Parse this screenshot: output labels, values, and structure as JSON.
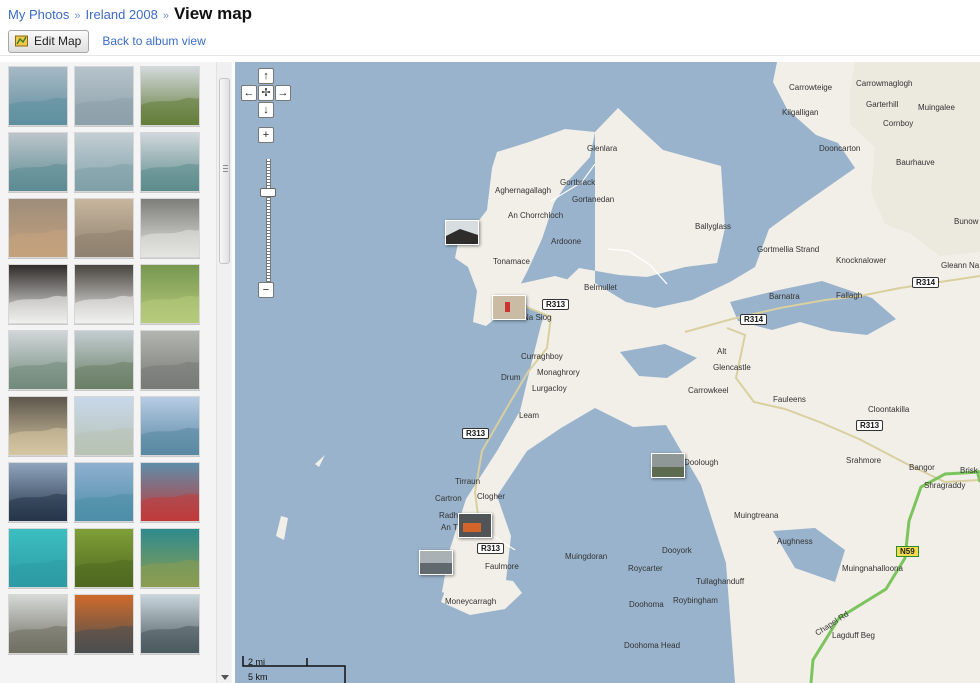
{
  "breadcrumb": {
    "items": [
      {
        "label": "My Photos",
        "separator": "»"
      },
      {
        "label": "Ireland 2008",
        "separator": "»"
      }
    ],
    "title": "View map"
  },
  "toolbar": {
    "edit_map_label": "Edit Map",
    "back_link_label": "Back to album view"
  },
  "thumbnails": {
    "count_visible": 27,
    "items": [
      {
        "colors": [
          "#a7b9c5",
          "#5f8f9f"
        ]
      },
      {
        "colors": [
          "#b6c3cb",
          "#8ca0aa"
        ]
      },
      {
        "colors": [
          "#d2d8da",
          "#647e3b"
        ]
      },
      {
        "colors": [
          "#bcc5cb",
          "#5d8c93"
        ]
      },
      {
        "colors": [
          "#c3ced4",
          "#7fa1a8"
        ]
      },
      {
        "colors": [
          "#d0d7db",
          "#5d8c8d"
        ]
      },
      {
        "colors": [
          "#9e8d7a",
          "#c4a27d"
        ]
      },
      {
        "colors": [
          "#c7b69d",
          "#8f8170"
        ]
      },
      {
        "colors": [
          "#7d7e79",
          "#e4e4e0"
        ]
      },
      {
        "colors": [
          "#2f2c29",
          "#efefed"
        ]
      },
      {
        "colors": [
          "#49453f",
          "#f0f0ee"
        ]
      },
      {
        "colors": [
          "#779750",
          "#b7cb7c"
        ]
      },
      {
        "colors": [
          "#d1d6d8",
          "#728b7c"
        ]
      },
      {
        "colors": [
          "#c3cdd1",
          "#6b8066"
        ]
      },
      {
        "colors": [
          "#b3b5b0",
          "#787a77"
        ]
      },
      {
        "colors": [
          "#5d574c",
          "#d6c7a3"
        ]
      },
      {
        "colors": [
          "#c8d8ea",
          "#b8c2b5"
        ]
      },
      {
        "colors": [
          "#b7cce4",
          "#5a88a3"
        ]
      },
      {
        "colors": [
          "#8fa4bd",
          "#263549"
        ]
      },
      {
        "colors": [
          "#8fb0d0",
          "#4c8ea7"
        ]
      },
      {
        "colors": [
          "#5f8eaa",
          "#c13a3a"
        ]
      },
      {
        "colors": [
          "#3bbfc0",
          "#2e9ba4"
        ]
      },
      {
        "colors": [
          "#7f9f37",
          "#4f6920"
        ]
      },
      {
        "colors": [
          "#2e8b8e",
          "#8b9d51"
        ]
      },
      {
        "colors": [
          "#d6d8d6",
          "#6f6f62"
        ]
      },
      {
        "colors": [
          "#cf6b2b",
          "#4b4f50"
        ]
      },
      {
        "colors": [
          "#c8d4db",
          "#4a5a5f"
        ]
      }
    ]
  },
  "map": {
    "places": [
      "Carrowteige",
      "Carrowmaglogh",
      "Kilgalligan",
      "Garterhill",
      "Muingalee",
      "Cornboy",
      "Glenlara",
      "Dooncarton",
      "Baurhauve",
      "Gortbrack",
      "Aghernagallagh",
      "Gortanedan",
      "An Chorrchloch",
      "Ardoone",
      "Tonamace",
      "Ballyglass",
      "Gortmellia Strand",
      "Knocknalower",
      "Belmullet",
      "Barnatra",
      "Fallagh",
      "Gleann Na Muaidhe",
      "Bunow",
      "Na Siog",
      "Curraghboy",
      "Monaghrory",
      "Drum",
      "Lurgacloy",
      "Alt",
      "Glencastle",
      "Carrowkeel",
      "Fauleens",
      "Leam",
      "Cloontakilla",
      "Srahmore",
      "Bangor",
      "Brisk",
      "Shragraddy",
      "Doolough",
      "Tirraun",
      "Clogher",
      "Cartron",
      "Radh",
      "An Tr",
      "Faulmore",
      "Muingtreana",
      "Aughness",
      "Dooyork",
      "Muingdoran",
      "Roycarter",
      "Tullaghanduff",
      "Muingnahalloona",
      "Roybingham",
      "Doohoma",
      "Lagduff Beg",
      "Doohoma Head",
      "Moneycarragh",
      "Chapel Rd"
    ],
    "roads": [
      "R313",
      "R314",
      "N59"
    ],
    "scale": {
      "miles": "2 mi",
      "km": "5 km"
    }
  },
  "colors": {
    "link": "#3c6bc5",
    "water": "#99b3cc",
    "land": "#f2efe8",
    "major_road": "#7cc45d"
  },
  "icons": {
    "edit_map": "map-edit-icon",
    "pan_up": "arrow-up-icon",
    "pan_down": "arrow-down-icon",
    "pan_left": "arrow-left-icon",
    "pan_right": "arrow-right-icon",
    "center": "center-icon",
    "zoom_in": "plus-icon",
    "zoom_out": "minus-icon"
  }
}
